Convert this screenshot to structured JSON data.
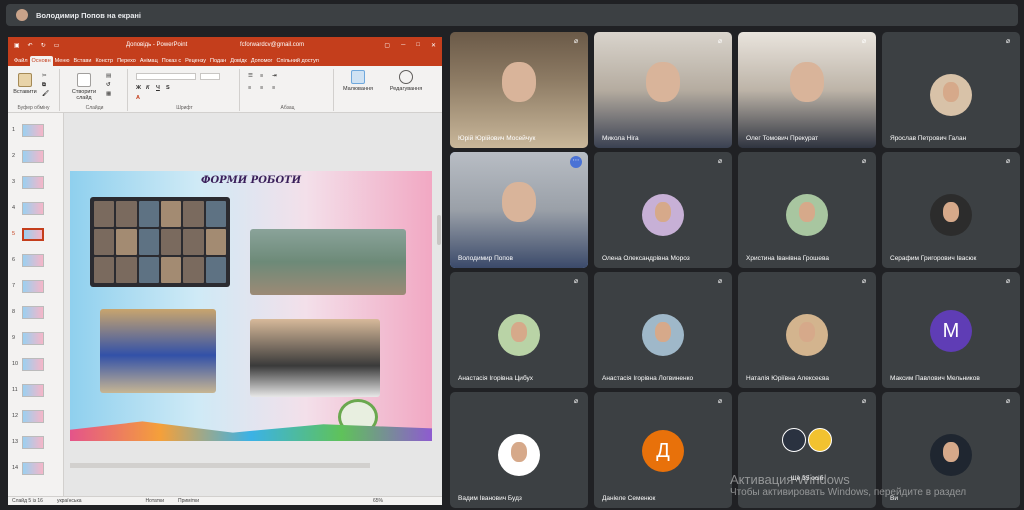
{
  "topbar": {
    "title": "Володимир Попов на екрані"
  },
  "ppt": {
    "doc_title": "Доповідь",
    "app_name": "PowerPoint",
    "account": "fcforwardcv@gmail.com",
    "tabs": [
      "Файл",
      "Основн",
      "Меню",
      "Встави",
      "Констр",
      "Перехо",
      "Анімац",
      "Показ с",
      "Рецензу",
      "Подан",
      "Довідк",
      "Допомог",
      "Спільний доступ"
    ],
    "groups": {
      "clipboard": "Буфер обміну",
      "slides": "Слайди",
      "font": "Шрифт",
      "paragraph": "Абзац"
    },
    "buttons": {
      "paste": "Вставити",
      "new_slide": "Створити слайд",
      "drawing": "Малювання",
      "editing": "Редагування"
    },
    "thumb_numbers": [
      "1",
      "2",
      "3",
      "4",
      "5",
      "6",
      "7",
      "8",
      "9",
      "10",
      "11",
      "12",
      "13",
      "14"
    ],
    "selected_thumb": "5",
    "slide_title": "ФОРМИ РОБОТИ",
    "status": {
      "slide": "Слайд 5 із 16",
      "lang": "українська",
      "notes": "Нотатки",
      "comments": "Примітки",
      "zoom": "65%"
    }
  },
  "participants": [
    {
      "name": "Юрій Юрійович Мосейчук",
      "type": "camera",
      "mic_muted": true
    },
    {
      "name": "Микола Ніга",
      "type": "camera",
      "mic_muted": true
    },
    {
      "name": "Олег Томович Прекурат",
      "type": "camera",
      "mic_muted": true
    },
    {
      "name": "Ярослав Петрович Галан",
      "type": "avatar",
      "mic_muted": true
    },
    {
      "name": "Володимир Попов",
      "type": "camera",
      "mic_muted": false,
      "active": true
    },
    {
      "name": "Олена Олександрівна Мороз",
      "type": "avatar",
      "mic_muted": true
    },
    {
      "name": "Христина Іванівна Грошева",
      "type": "avatar",
      "mic_muted": true
    },
    {
      "name": "Серафим Григорович Івасюк",
      "type": "avatar",
      "mic_muted": true
    },
    {
      "name": "Анастасія Ігорівна Цибух",
      "type": "avatar",
      "mic_muted": true
    },
    {
      "name": "Анастасія Ігорівна Логвиненко",
      "type": "avatar",
      "mic_muted": true
    },
    {
      "name": "Наталія Юріївна Алексеєва",
      "type": "avatar",
      "mic_muted": true
    },
    {
      "name": "Максим Павлович Мельников",
      "type": "letter",
      "letter": "М",
      "color": "#5f3db5",
      "mic_muted": true
    },
    {
      "name": "Вадим Іванович Будз",
      "type": "avatar",
      "mic_muted": true
    },
    {
      "name": "Даніеле Семенюк",
      "type": "letter",
      "letter": "Д",
      "color": "#e8710a",
      "mic_muted": true
    },
    {
      "name": "",
      "type": "more",
      "count_text": "Ще 35 осіб",
      "mic_muted": true
    },
    {
      "name": "Ви",
      "type": "avatar",
      "mic_muted": true
    }
  ],
  "windows_activation": {
    "line1": "Активация Windows",
    "line2": "Чтобы активировать Windows, перейдите в раздел"
  },
  "colors": {
    "ppt_accent": "#c43e1c",
    "meet_bg": "#202124",
    "tile_bg": "#3c4043"
  },
  "icons": [
    "mic-off-icon",
    "more-options-icon",
    "paste-icon",
    "new-slide-icon",
    "drawing-icon",
    "search-icon"
  ]
}
